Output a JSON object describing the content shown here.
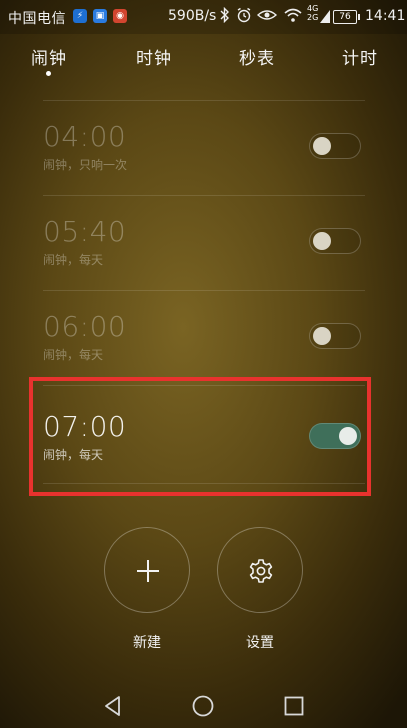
{
  "status_bar": {
    "carrier": "中国电信",
    "app_icons": [
      {
        "name": "running-app-icon",
        "color": "#1e6fd1",
        "glyph": "⚡"
      },
      {
        "name": "gallery-app-icon",
        "color": "#2a7be0",
        "glyph": "▣"
      },
      {
        "name": "weibo-app-icon",
        "color": "#d2452f",
        "glyph": "◉"
      }
    ],
    "net_speed": "590B/s",
    "network_top": "4G",
    "network_bottom": "2G",
    "battery": "76",
    "time": "14:41"
  },
  "tabs": [
    {
      "label": "闹钟",
      "active": true
    },
    {
      "label": "时钟",
      "active": false
    },
    {
      "label": "秒表",
      "active": false
    },
    {
      "label": "计时",
      "active": false
    }
  ],
  "alarms": [
    {
      "time": "04:00",
      "desc": "闹钟，只响一次",
      "enabled": false
    },
    {
      "time": "05:40",
      "desc": "闹钟，每天",
      "enabled": false
    },
    {
      "time": "06:00",
      "desc": "闹钟，每天",
      "enabled": false
    },
    {
      "time": "07:00",
      "desc": "闹钟，每天",
      "enabled": true
    }
  ],
  "actions": {
    "new_label": "新建",
    "settings_label": "设置"
  },
  "colors": {
    "highlight_border": "#e8322e",
    "toggle_on": "#3f6f5a"
  }
}
